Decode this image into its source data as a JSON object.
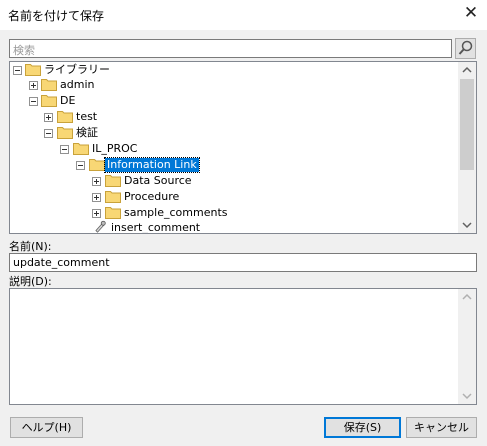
{
  "window": {
    "title": "名前を付けて保存",
    "close_glyph": "✕"
  },
  "search": {
    "placeholder": "検索"
  },
  "tree": {
    "items": [
      {
        "label": "ライブラリー",
        "expander": "minus",
        "icon": "folder-icon"
      },
      {
        "label": "admin",
        "expander": "plus",
        "icon": "folder-icon"
      },
      {
        "label": "DE",
        "expander": "minus",
        "icon": "folder-icon"
      },
      {
        "label": "test",
        "expander": "plus",
        "icon": "folder-icon"
      },
      {
        "label": "検証",
        "expander": "minus",
        "icon": "folder-icon"
      },
      {
        "label": "IL_PROC",
        "expander": "minus",
        "icon": "folder-icon"
      },
      {
        "label": "Information Link",
        "expander": "minus",
        "icon": "folder-icon",
        "selected": true
      },
      {
        "label": "Data Source",
        "expander": "plus",
        "icon": "folder-icon"
      },
      {
        "label": "Procedure",
        "expander": "plus",
        "icon": "folder-icon"
      },
      {
        "label": "sample_comments",
        "expander": "plus",
        "icon": "folder-icon"
      },
      {
        "label": "insert_comment",
        "expander": "none",
        "icon": "procedure-icon"
      }
    ]
  },
  "name_field": {
    "label": "名前(N):",
    "value": "update_comment"
  },
  "description_field": {
    "label": "説明(D):",
    "value": ""
  },
  "buttons": {
    "help": "ヘルプ(H)",
    "save": "保存(S)",
    "cancel": "キャンセル"
  },
  "colors": {
    "selection": "#0078d7",
    "folder": "#f8d775"
  }
}
